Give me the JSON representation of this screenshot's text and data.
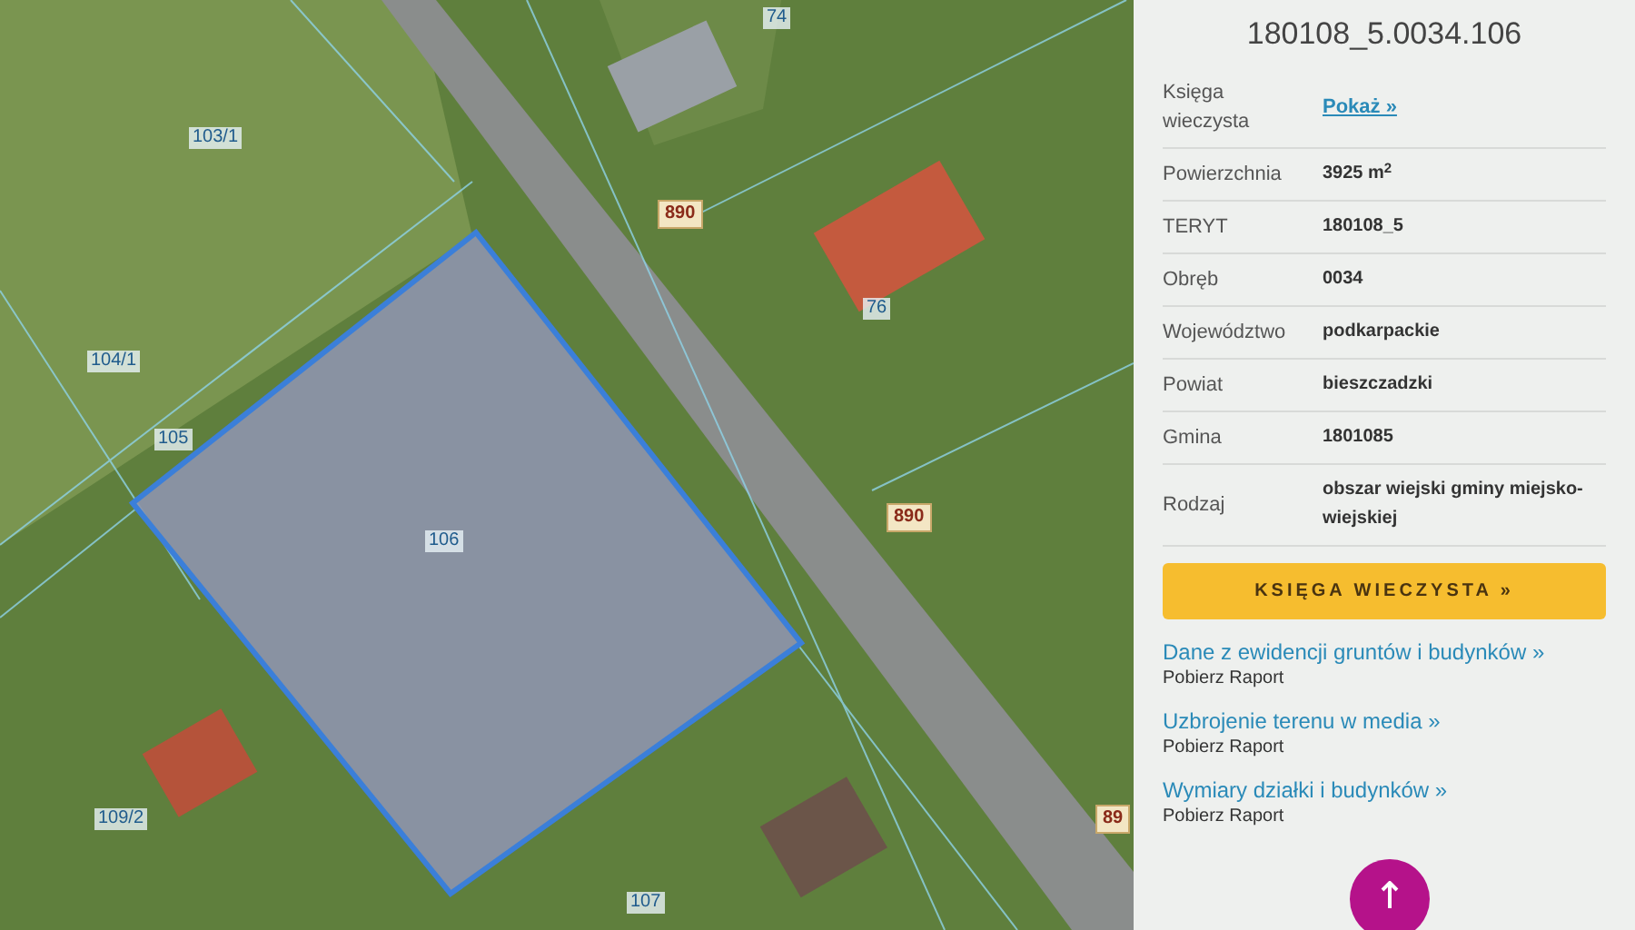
{
  "map": {
    "parcel_labels": [
      "103/1",
      "104/1",
      "105",
      "106",
      "109/2",
      "107",
      "74",
      "76"
    ],
    "road_labels": [
      "890",
      "890",
      "89"
    ]
  },
  "panel": {
    "title": "180108_5.0034.106",
    "rows": [
      {
        "label": "Księga wieczysta",
        "value": "Pokaż »",
        "kind": "link"
      },
      {
        "label": "Powierzchnia",
        "value": "3925 m$^{2}$",
        "kind": "text"
      },
      {
        "label": "TERYT",
        "value": "180108_5",
        "kind": "text"
      },
      {
        "label": "Obręb",
        "value": "0034",
        "kind": "text"
      },
      {
        "label": "Województwo",
        "value": "podkarpackie",
        "kind": "text"
      },
      {
        "label": "Powiat",
        "value": "bieszczadzki",
        "kind": "text"
      },
      {
        "label": "Gmina",
        "value": "1801085",
        "kind": "text"
      },
      {
        "label": "Rodzaj",
        "value": "obszar wiejski gminy miejsko-wiejskiej",
        "kind": "text"
      }
    ],
    "button": "KSIĘGA WIECZYSTA »",
    "reports": [
      {
        "title": "Dane z ewidencji gruntów i budynków »",
        "action": "Pobierz Raport"
      },
      {
        "title": "Uzbrojenie terenu w media »",
        "action": "Pobierz Raport"
      },
      {
        "title": "Wymiary działki i budynków »",
        "action": "Pobierz Raport"
      }
    ]
  }
}
